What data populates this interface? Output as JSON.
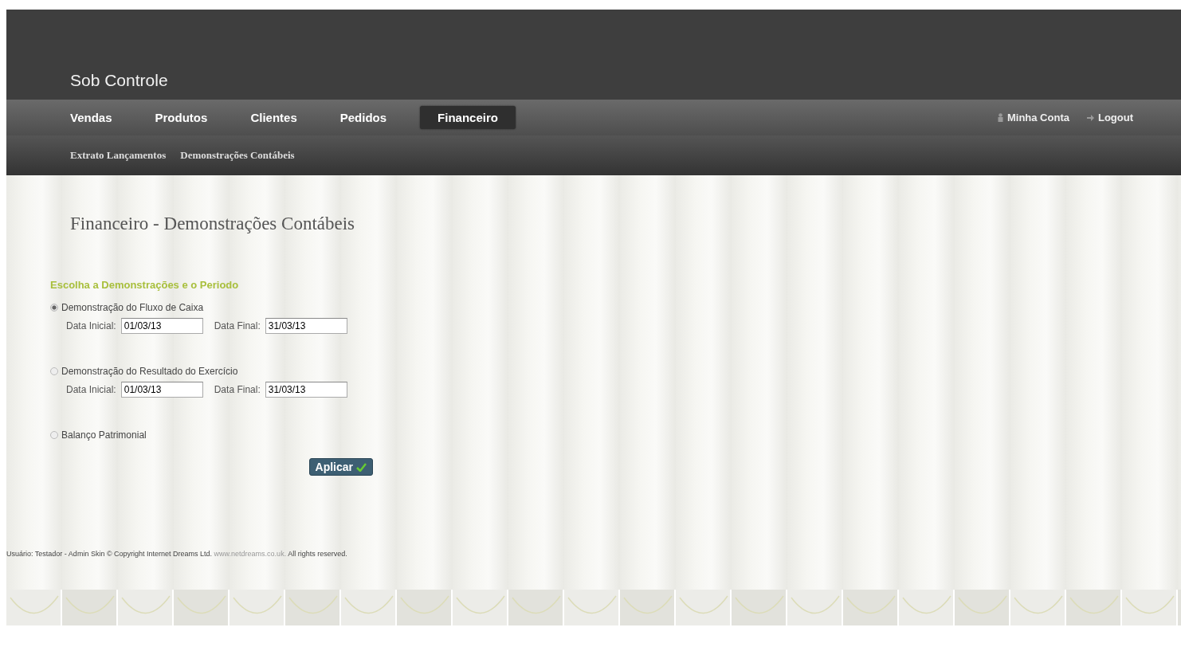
{
  "brand": "Sob Controle",
  "nav": [
    {
      "label": "Vendas",
      "selected": false
    },
    {
      "label": "Produtos",
      "selected": false
    },
    {
      "label": "Clientes",
      "selected": false
    },
    {
      "label": "Pedidos",
      "selected": false
    },
    {
      "label": "Financeiro",
      "selected": true
    }
  ],
  "account_links": [
    {
      "kind": "user",
      "label": "Minha Conta"
    },
    {
      "kind": "logout",
      "label": "Logout"
    }
  ],
  "subnav": [
    "Extrato Lançamentos",
    "Demonstrações Contábeis"
  ],
  "page_title": "Financeiro - Demonstrações Contábeis",
  "section_title": "Escolha a Demonstrações e o Periodo",
  "statements": [
    {
      "label": "Demonstração do Fluxo de Caixa",
      "selected": true,
      "start_label": "Data Inicial:",
      "start_value": "01/03/13",
      "end_label": "Data Final:",
      "end_value": "31/03/13"
    },
    {
      "label": "Demonstração do Resultado do Exercício",
      "selected": false,
      "start_label": "Data Inicial:",
      "start_value": "01/03/13",
      "end_label": "Data Final:",
      "end_value": "31/03/13"
    },
    {
      "label": "Balanço Patrimonial",
      "selected": false
    }
  ],
  "apply_button": "Aplicar",
  "footer": {
    "text": "Usuário: Testador - Admin Skin © Copyright Internet Dreams Ltd.",
    "link": "www.netdreams.co.uk.",
    "rights": "All rights reserved."
  }
}
